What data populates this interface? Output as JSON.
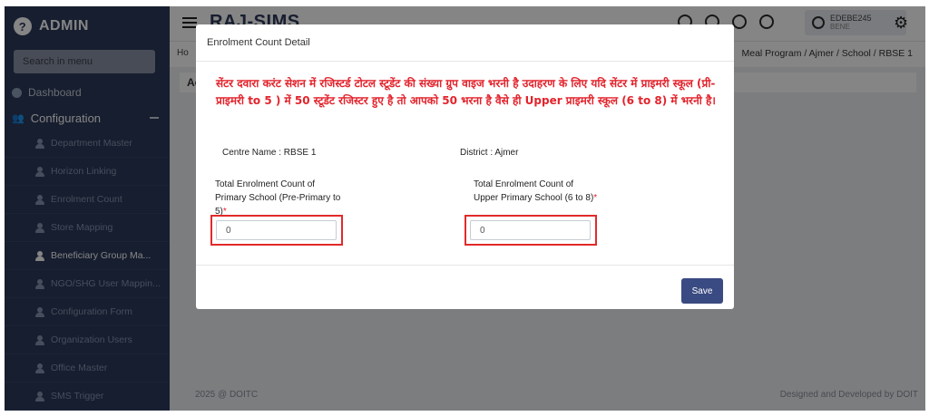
{
  "sidebar": {
    "brand": "ADMIN",
    "brand_icon": "admin-logo-icon",
    "search_placeholder": "Search in menu",
    "dashboard": "Dashboard",
    "configuration": "Configuration",
    "items": [
      {
        "label": "Department Master"
      },
      {
        "label": "Horizon Linking"
      },
      {
        "label": "Enrolment Count"
      },
      {
        "label": "Store Mapping"
      },
      {
        "label": "Beneficiary Group Ma..."
      },
      {
        "label": "NGO/SHG User Mappin..."
      },
      {
        "label": "Configuration Form"
      },
      {
        "label": "Organization Users"
      },
      {
        "label": "Office Master"
      },
      {
        "label": "SMS Trigger"
      }
    ]
  },
  "topbar": {
    "title": "RAJ-SIMS",
    "user_id": "EDEBE245",
    "user_role": "BENE"
  },
  "breadcrumb": {
    "home": "Ho",
    "trail": "Meal Program / Ajmer / School / RBSE 1"
  },
  "content": {
    "header": "Ac"
  },
  "footer": {
    "left": "2025 @ DOITC",
    "right": "Designed and Developed by DOIT"
  },
  "modal": {
    "title": "Enrolment Count Detail",
    "notice": "सेंटर दवारा करंट सेशन में रजिस्टर्ड टोटल स्टूडेंट की संख्या ग्रुप वाइज भरनी है उदाहरण के लिए यदि सेंटर में प्राइमरी स्कूल (प्री-प्राइमरी to 5 ) में 50 स्टूडेंट रजिस्टर हुए है तो आपको 50 भरना है वैसे ही Upper प्राइमरी स्कूल (6 to 8) में भरनी है।",
    "centre_name": "Centre Name : RBSE 1",
    "district": "District : Ajmer",
    "primary_label": "Total Enrolment Count of Primary School (Pre-Primary to 5)",
    "primary_value": "0",
    "upper_label": "Total Enrolment Count of Upper Primary School (6 to 8)",
    "upper_value": "0",
    "required_mark": "*",
    "save_label": "Save"
  },
  "colors": {
    "sidebar_bg": "#2c3a5a",
    "notice_red": "#e3232c",
    "highlight_red": "#e22a2a",
    "save_button": "#3a4a82"
  }
}
